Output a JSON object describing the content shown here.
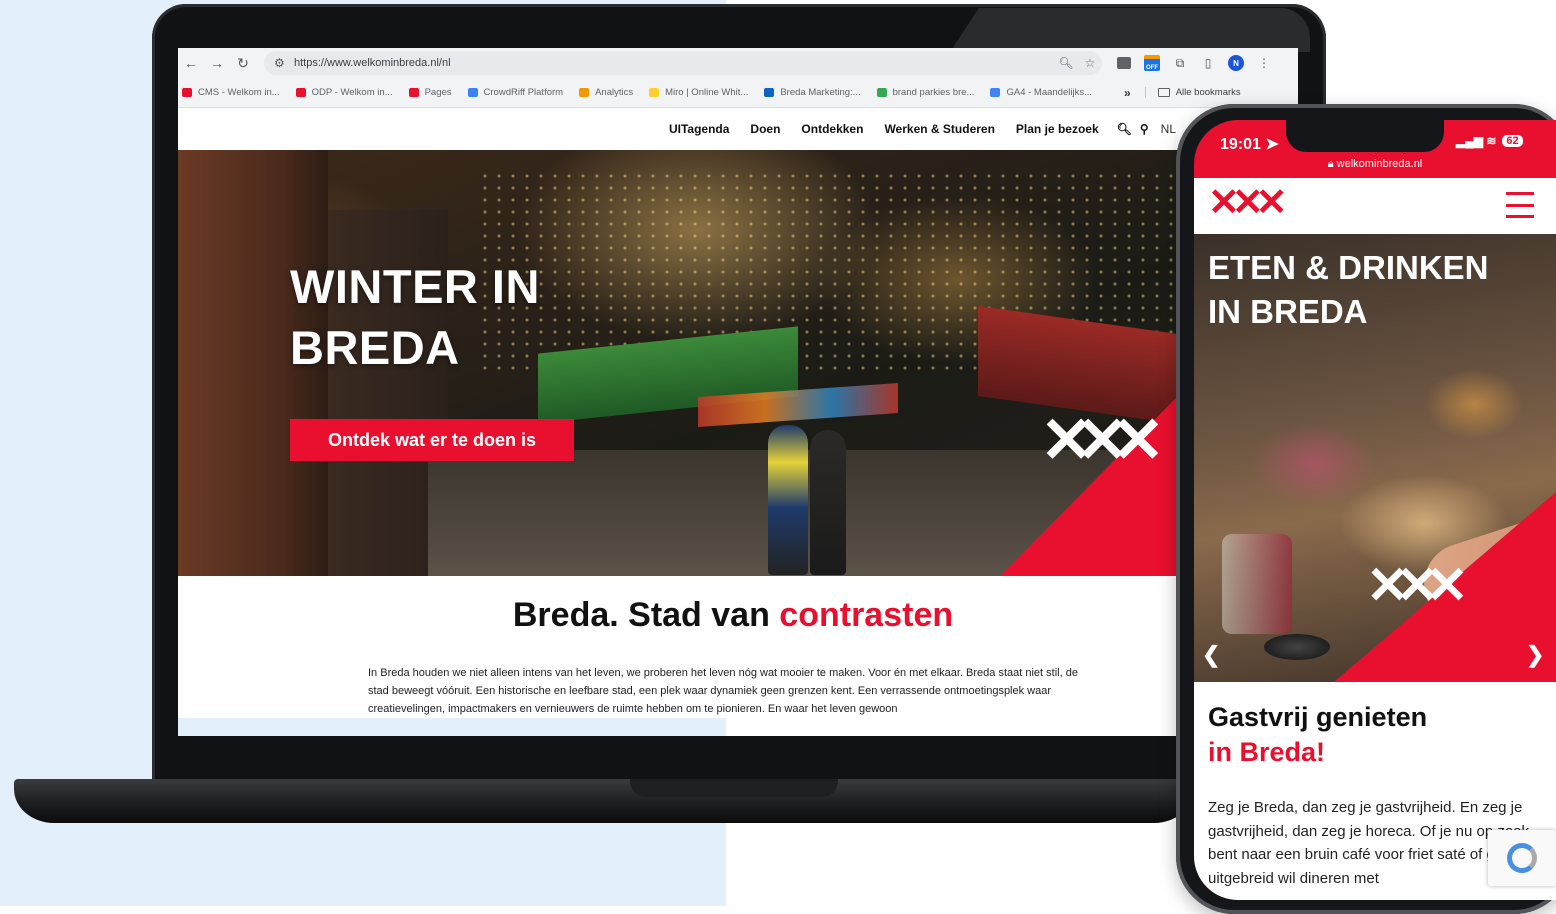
{
  "browser": {
    "url": "https://www.welkominbreda.nl/nl",
    "bookmarks": [
      {
        "label": "CMS - Welkom in...",
        "color": "#e8102e"
      },
      {
        "label": "ODP - Welkom in...",
        "color": "#e8102e"
      },
      {
        "label": "Pages",
        "color": "#e8102e"
      },
      {
        "label": "CrowdRiff Platform",
        "color": "#3b82f6"
      },
      {
        "label": "Analytics",
        "color": "#f29900"
      },
      {
        "label": "Miro | Online Whit...",
        "color": "#ffd02f"
      },
      {
        "label": "Breda Marketing:...",
        "color": "#0a66c2"
      },
      {
        "label": "brand parkies bre...",
        "color": "#34a853"
      },
      {
        "label": "GA4 - Maandelijks...",
        "color": "#4285f4"
      }
    ],
    "more": "»",
    "all_bookmarks": "Alle bookmarks",
    "profile_initial": "N",
    "extension_badge": "OFF"
  },
  "site": {
    "nav": [
      "UITagenda",
      "Doen",
      "Ontdekken",
      "Werken & Studeren",
      "Plan je bezoek"
    ],
    "lang": "NL",
    "hero": {
      "title_line1": "WINTER IN",
      "title_line2": "BREDA",
      "cta": "Ontdek wat er te doen is"
    },
    "content": {
      "title_main": "Breda. Stad van ",
      "title_accent": "contrasten",
      "body": "In Breda houden we niet alleen intens van het leven, we proberen het leven nóg wat mooier te maken. Voor én met elkaar. Breda staat niet stil, de stad beweegt vóóruit. Een historische en leefbare stad, een plek waar dynamiek geen grenzen kent. Een verrassende ontmoetingsplek waar creatievelingen, impactmakers en vernieuwers de ruimte hebben om te pionieren. En waar het leven gewoon"
    },
    "colors": {
      "brand_red": "#e8102e"
    }
  },
  "phone": {
    "time": "19:01",
    "battery": "62",
    "url": "welkominbreda.nl",
    "hero_line1": "ETEN & DRINKEN",
    "hero_line2": "IN BREDA",
    "heading_line1": "Gastvrij genieten",
    "heading_line2": "in Breda!",
    "body": "Zeg je Breda, dan zeg je gastvrijheid. En zeg je gastvrijheid, dan zeg je horeca. Of je nu op zoek bent naar een bruin café voor friet saté of graag uitgebreid wil dineren met"
  }
}
